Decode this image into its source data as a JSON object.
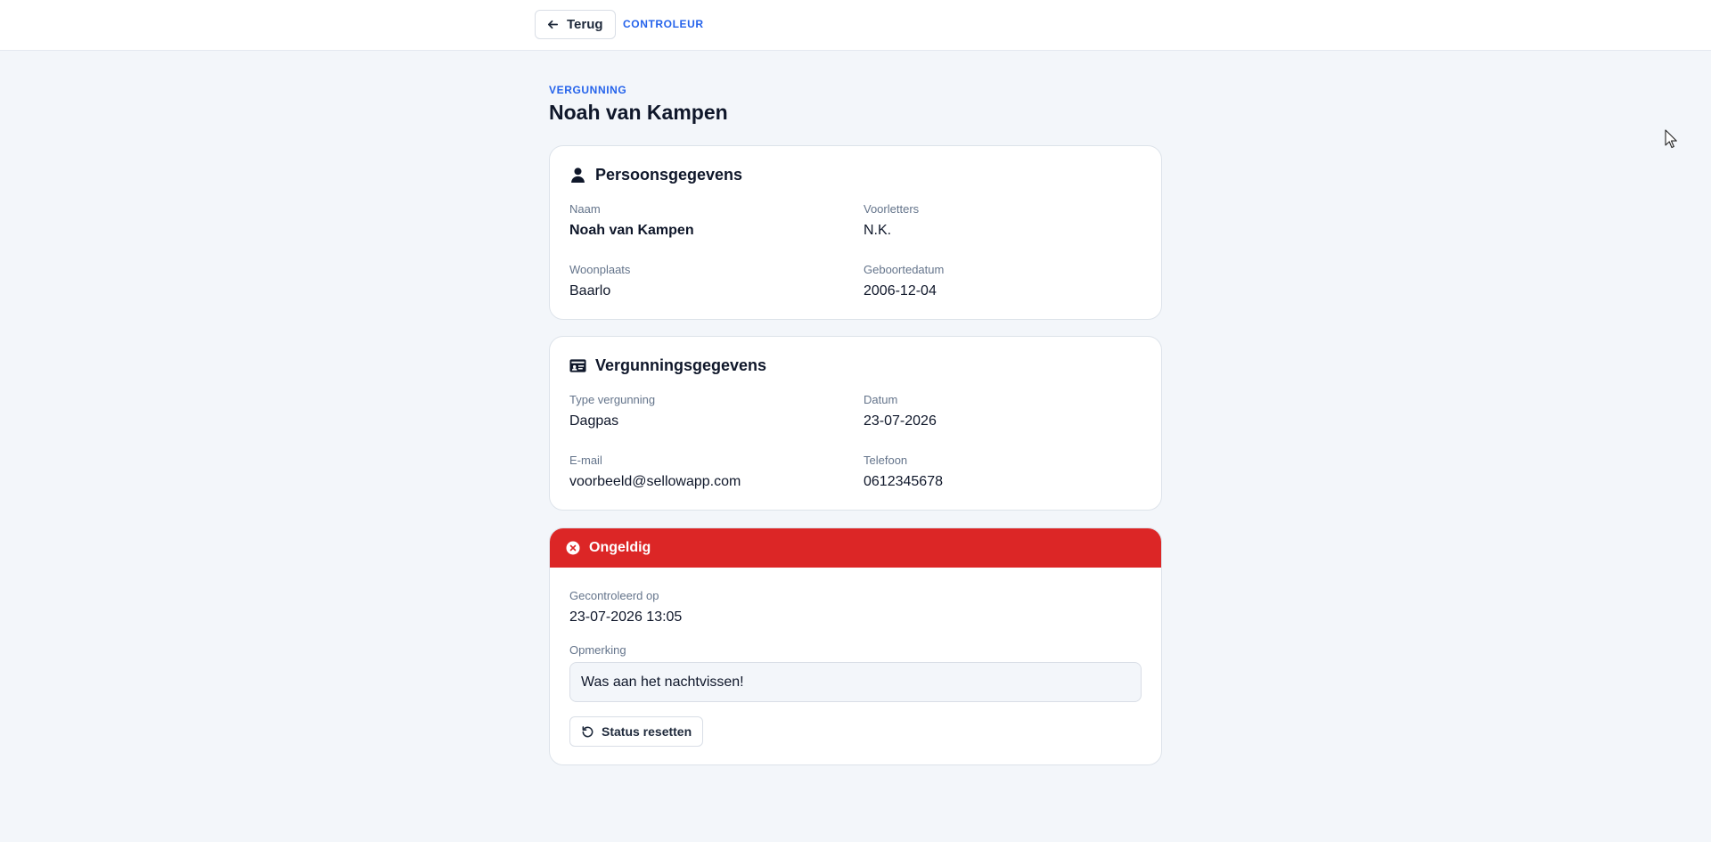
{
  "header": {
    "back_label": "Terug",
    "role_label": "CONTROLEUR"
  },
  "page": {
    "eyebrow": "VERGUNNING",
    "title": "Noah van Kampen"
  },
  "personal": {
    "title": "Persoonsgegevens",
    "icon": "person-icon",
    "fields": [
      {
        "label": "Naam",
        "value": "Noah van Kampen"
      },
      {
        "label": "Voorletters",
        "value": "N.K."
      },
      {
        "label": "Woonplaats",
        "value": "Baarlo"
      },
      {
        "label": "Geboortedatum",
        "value": "2006-12-04"
      }
    ]
  },
  "permit": {
    "title": "Vergunningsgegevens",
    "icon": "id-card-icon",
    "fields": [
      {
        "label": "Type vergunning",
        "value": "Dagpas"
      },
      {
        "label": "Datum",
        "value": "23-07-2026"
      },
      {
        "label": "E-mail",
        "value": "voorbeeld@sellowapp.com"
      },
      {
        "label": "Telefoon",
        "value": "0612345678"
      }
    ]
  },
  "status": {
    "label": "Ongeldig",
    "color": "#dc2626",
    "icon": "x-circle-icon",
    "checked_label": "Gecontroleerd op",
    "checked_value": "23-07-2026 13:05",
    "remark_label": "Opmerking",
    "remark_value": "Was aan het nachtvissen!",
    "reset_label": "Status resetten"
  },
  "colors": {
    "accent": "#2563eb",
    "background": "#f3f6fa",
    "invalid": "#dc2626"
  }
}
